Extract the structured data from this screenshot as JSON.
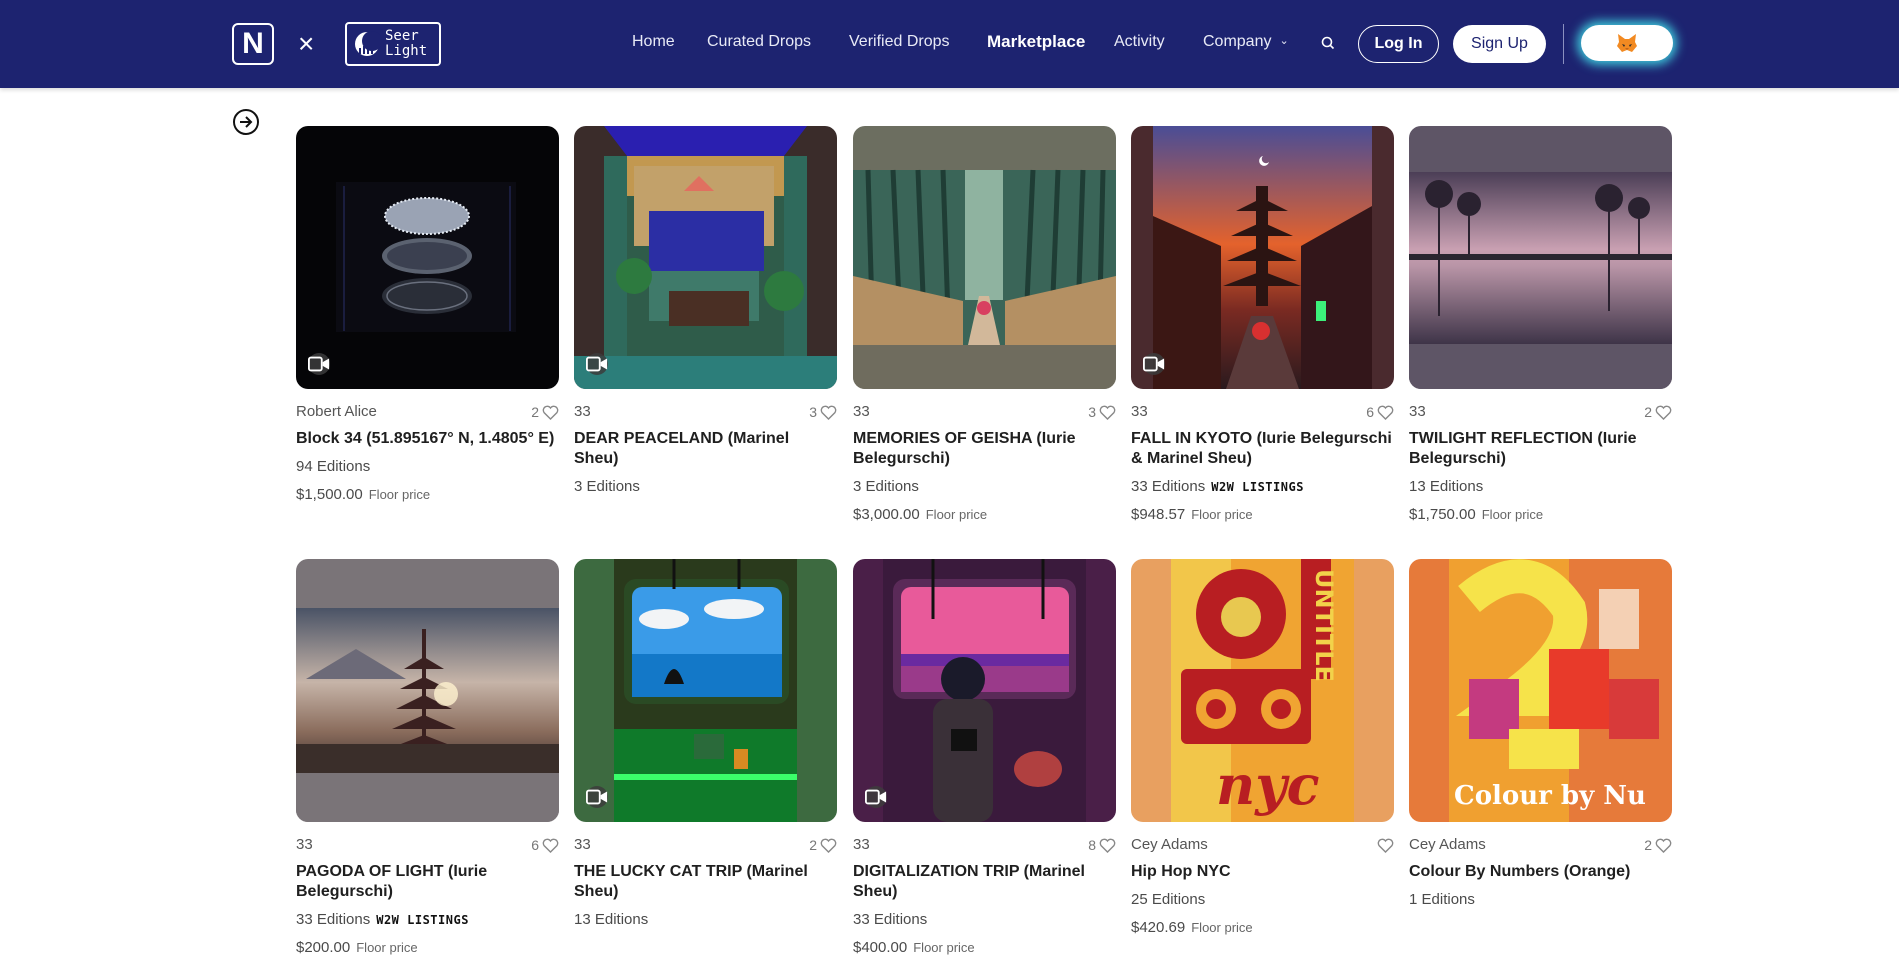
{
  "header": {
    "logo_letter": "N",
    "times": "×",
    "partner_line1": "Seer",
    "partner_line2": "Light",
    "nav": [
      "Home",
      "Curated Drops",
      "Verified Drops",
      "Marketplace",
      "Activity",
      "Company"
    ],
    "active_nav": "Marketplace",
    "login_label": "Log In",
    "signup_label": "Sign Up",
    "wallet_icon": "fox-icon"
  },
  "colors": {
    "header_bg": "#1d2370",
    "wallet_glow": "#3ec6d9"
  },
  "cards": [
    {
      "creator": "Robert Alice",
      "likes": "2",
      "title": "Block 34 (51.895167° N, 1.4805° E)",
      "editions": "94 Editions",
      "w2w": "",
      "price": "$1,500.00",
      "floor": "Floor price",
      "video": true
    },
    {
      "creator": "33",
      "likes": "3",
      "title": "DEAR PEACELAND (Marinel Sheu)",
      "editions": "3 Editions",
      "w2w": "",
      "price": "",
      "floor": "",
      "video": true
    },
    {
      "creator": "33",
      "likes": "3",
      "title": "MEMORIES OF GEISHA (Iurie Belegurschi)",
      "editions": "3 Editions",
      "w2w": "",
      "price": "$3,000.00",
      "floor": "Floor price",
      "video": false
    },
    {
      "creator": "33",
      "likes": "6",
      "title": "FALL IN KYOTO (Iurie Belegurschi & Marinel Sheu)",
      "editions": "33 Editions",
      "w2w": "W2W LISTINGS",
      "price": "$948.57",
      "floor": "Floor price",
      "video": true
    },
    {
      "creator": "33",
      "likes": "2",
      "title": "TWILIGHT REFLECTION (Iurie Belegurschi)",
      "editions": "13 Editions",
      "w2w": "",
      "price": "$1,750.00",
      "floor": "Floor price",
      "video": false
    },
    {
      "creator": "33",
      "likes": "6",
      "title": "PAGODA OF LIGHT (Iurie Belegurschi)",
      "editions": "33 Editions",
      "w2w": "W2W LISTINGS",
      "price": "$200.00",
      "floor": "Floor price",
      "video": false
    },
    {
      "creator": "33",
      "likes": "2",
      "title": "THE LUCKY CAT TRIP (Marinel Sheu)",
      "editions": "13 Editions",
      "w2w": "",
      "price": "",
      "floor": "",
      "video": true
    },
    {
      "creator": "33",
      "likes": "8",
      "title": "DIGITALIZATION TRIP (Marinel Sheu)",
      "editions": "33 Editions",
      "w2w": "",
      "price": "$400.00",
      "floor": "Floor price",
      "video": true
    },
    {
      "creator": "Cey Adams",
      "likes": "",
      "title": "Hip Hop NYC",
      "editions": "25 Editions",
      "w2w": "",
      "price": "$420.69",
      "floor": "Floor price",
      "video": false
    },
    {
      "creator": "Cey Adams",
      "likes": "2",
      "title": "Colour By Numbers (Orange)",
      "editions": "1 Editions",
      "w2w": "",
      "price": "",
      "floor": "",
      "video": false
    }
  ],
  "artwork_text": {
    "nyc": "nyc",
    "colour": "Colour by Nu",
    "untitled": "UNTITLE"
  }
}
